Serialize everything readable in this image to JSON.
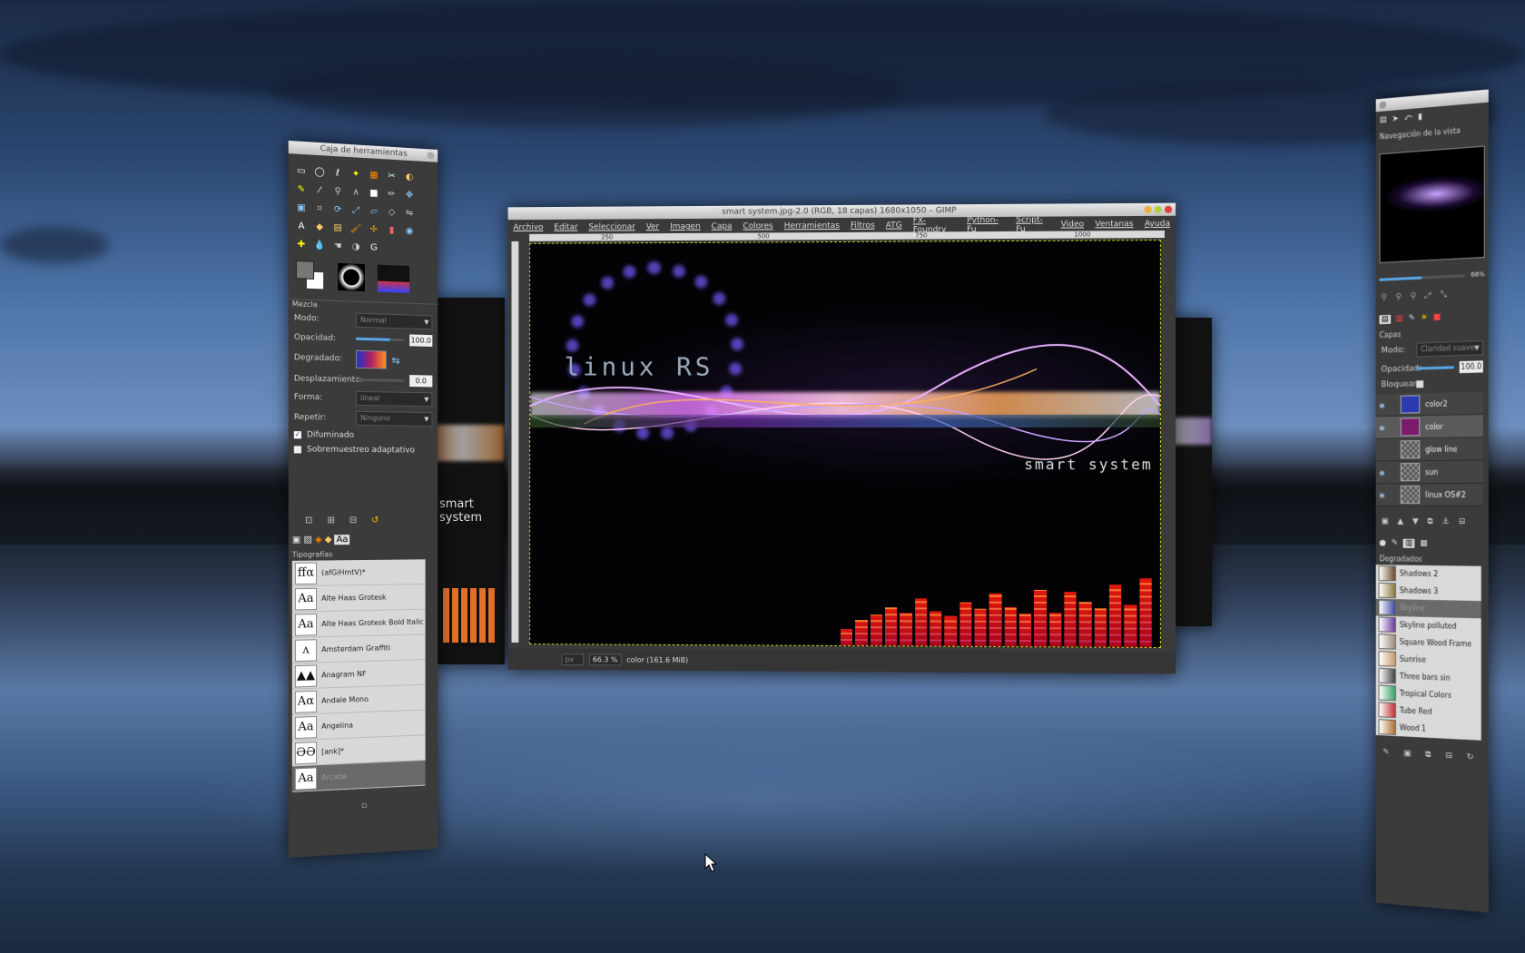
{
  "desktop": {
    "background": "night lake"
  },
  "toolbox": {
    "title": "Caja de herramientas",
    "tool_options_title": "Mezcla",
    "mode_label": "Modo:",
    "mode_value": "Normal",
    "opacity_label": "Opacidad:",
    "opacity_value": "100.0",
    "gradient_label": "Degradado:",
    "offset_label": "Desplazamiento:",
    "offset_value": "0.0",
    "shape_label": "Forma:",
    "shape_value": "lineal",
    "repeat_label": "Repetir:",
    "repeat_value": "Ninguno",
    "dither_label": "Difuminado",
    "supersample_label": "Sobremuestreo adaptativo",
    "fonts_title": "Tipografías",
    "fonts": [
      {
        "glyph": "ffα",
        "name": "(afGiHmtV)*"
      },
      {
        "glyph": "Aa",
        "name": "Alte Haas Grotesk"
      },
      {
        "glyph": "Aa",
        "name": "Alte Haas Grotesk Bold Italic"
      },
      {
        "glyph": "ᴧ",
        "name": "Amsterdam Graffiti"
      },
      {
        "glyph": "▲▲",
        "name": "Anagram NF"
      },
      {
        "glyph": "Aα",
        "name": "Andale Mono"
      },
      {
        "glyph": "Aa",
        "name": "Angelina"
      },
      {
        "glyph": "ƏƏ",
        "name": "[ank]*"
      },
      {
        "glyph": "Aa",
        "name": "Arcade"
      }
    ]
  },
  "image_window": {
    "title": "smart system.jpg-2.0 (RGB, 18 capas) 1680x1050 – GIMP",
    "menu": [
      "Archivo",
      "Editar",
      "Seleccionar",
      "Ver",
      "Imagen",
      "Capa",
      "Colores",
      "Herramientas",
      "Filtros",
      "ATG",
      "FX-Foundry",
      "Python-Fu",
      "Script-Fu",
      "Video",
      "Ventanas",
      "Ayuda"
    ],
    "ruler_marks": [
      "250",
      "500",
      "750",
      "1000"
    ],
    "canvas_logo": "linux RS",
    "canvas_text": "smart system",
    "status_unit": "px",
    "status_zoom": "66.3 %",
    "status_text": "color (161.6 MiB)",
    "bars": [
      0.18,
      0.28,
      0.34,
      0.42,
      0.36,
      0.52,
      0.38,
      0.33,
      0.48,
      0.41,
      0.58,
      0.43,
      0.36,
      0.62,
      0.37,
      0.6,
      0.49,
      0.42,
      0.68,
      0.46,
      0.75
    ]
  },
  "left_ghost_window": {
    "text": "smart system"
  },
  "dock": {
    "navigation_title": "Navegación de la vista",
    "zoom_value": "66%",
    "layers_title": "Capas",
    "mode_label": "Modo:",
    "mode_value": "Claridad suave",
    "opacity_label": "Opacidad:",
    "opacity_value": "100.0",
    "lock_label": "Bloquear:",
    "layers": [
      {
        "name": "color2",
        "visible": true,
        "color": "#2b3cb0"
      },
      {
        "name": "color",
        "visible": true,
        "color": "#7a1b6b"
      },
      {
        "name": "glow line",
        "visible": false,
        "color": "#777"
      },
      {
        "name": "sun",
        "visible": true,
        "color": "#777"
      },
      {
        "name": "linux OS#2",
        "visible": true,
        "color": "#777"
      }
    ],
    "gradients_title": "Degradados",
    "gradients": [
      {
        "name": "Shadows 2",
        "color": "#6b4a2a"
      },
      {
        "name": "Shadows 3",
        "color": "#8a7a3a"
      },
      {
        "name": "Skyline",
        "color": "#3b4aa0"
      },
      {
        "name": "Skyline polluted",
        "color": "#6a3aa0"
      },
      {
        "name": "Square Wood Frame",
        "color": "#9a8a7a"
      },
      {
        "name": "Sunrise",
        "color": "#c89a6a"
      },
      {
        "name": "Three bars sin",
        "color": "#444444"
      },
      {
        "name": "Tropical Colors",
        "color": "#3aa060"
      },
      {
        "name": "Tube Red",
        "color": "#c03030"
      },
      {
        "name": "Wood 1",
        "color": "#b07030"
      }
    ]
  }
}
